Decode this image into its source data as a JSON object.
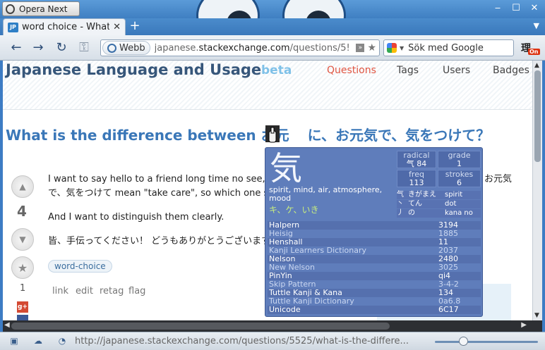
{
  "window": {
    "app_button": "Opera Next",
    "controls": [
      "‒",
      "☐",
      "✕"
    ]
  },
  "tabs": [
    {
      "favicon": "JP",
      "title": "word choice - What...",
      "close": "✕"
    }
  ],
  "new_tab": "+",
  "toolbar": {
    "back": "←",
    "forward": "→",
    "reload": "↻",
    "key": "⚿",
    "address_badge": "Webb",
    "url_prefix": "japanese.",
    "url_domain": "stackexchange.com",
    "url_rest": "/questions/5!",
    "search_placeholder": "Sök med Google",
    "rikai_label": "理",
    "rikai_state": "On"
  },
  "site": {
    "title": "Japanese Language and Usage",
    "beta": "beta",
    "nav": [
      {
        "label": "Questions",
        "active": true
      },
      {
        "label": "Tags",
        "active": false
      },
      {
        "label": "Users",
        "active": false
      },
      {
        "label": "Badges",
        "active": false
      }
    ]
  },
  "question": {
    "title_start": "What is the difference between お元",
    "title_end": "に、お元気で、気をつけて？",
    "votes": "4",
    "favorites": "1",
    "body_line1": "I want to say hello to a friend long time no see, ar",
    "body_line1_end": "お元気",
    "body_line2": "で、気をつけて mean \"take care\", so which one sui",
    "body_para2": "And I want to distinguish them clearly.",
    "body_para3": "皆、手伝ってください！ どうもありがとうございます!",
    "tag": "word-choice",
    "menu": [
      "link",
      "edit",
      "retag",
      "flag"
    ]
  },
  "popup": {
    "kanji": "気",
    "radical_label": "radical",
    "radical_value": "气 84",
    "grade_label": "grade",
    "grade_value": "1",
    "freq_label": "freq",
    "freq_value": "113",
    "strokes_label": "strokes",
    "strokes_value": "6",
    "meaning": "spirit, mind, air, atmosphere, mood",
    "readings": "キ、ケ、いき",
    "radicals": [
      {
        "glyph": "气",
        "reading": "きがまえ",
        "meaning": "spirit"
      },
      {
        "glyph": "丶",
        "reading": "てん",
        "meaning": "dot"
      },
      {
        "glyph": "丿",
        "reading": "の",
        "meaning": "kana no"
      }
    ],
    "dictionary": [
      {
        "name": "Halpern",
        "value": "3194"
      },
      {
        "name": "Heisig",
        "value": "1885"
      },
      {
        "name": "Henshall",
        "value": "11"
      },
      {
        "name": "Kanji Learners Dictionary",
        "value": "2037"
      },
      {
        "name": "Nelson",
        "value": "2480"
      },
      {
        "name": "New Nelson",
        "value": "3025"
      },
      {
        "name": "PinYin",
        "value": "qi4"
      },
      {
        "name": "Skip Pattern",
        "value": "3-4-2"
      },
      {
        "name": "Tuttle Kanji & Kana",
        "value": "134"
      },
      {
        "name": "Tuttle Kanji Dictionary",
        "value": "0a6.8"
      },
      {
        "name": "Unicode",
        "value": "6C17"
      }
    ]
  },
  "status": {
    "url": "http://japanese.stackexchange.com/questions/5525/what-is-the-differe..."
  },
  "colors": {
    "accent": "#3a77b8",
    "popup_bg": "#5f7dbb",
    "nav_active": "#e05542"
  }
}
